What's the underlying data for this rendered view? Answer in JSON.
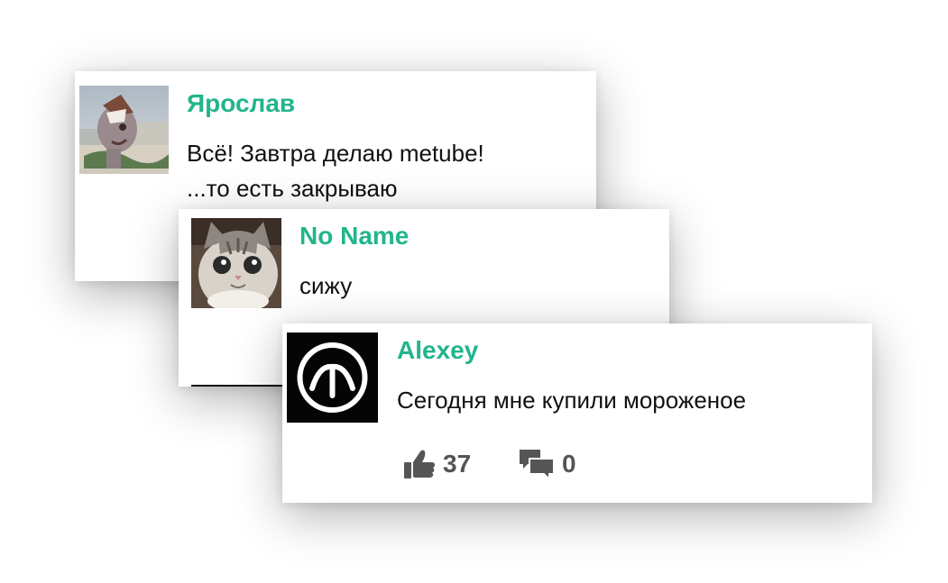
{
  "comments": [
    {
      "author": "Ярослав",
      "text": "Всё! Завтра делаю metube!\n...то есть закрываю"
    },
    {
      "author": "No Name",
      "text": "сижу"
    },
    {
      "author": "Alexey",
      "text": "Сегодня мне купили мороженое",
      "likes": "37",
      "replies": "0"
    }
  ],
  "colors": {
    "author": "#22b58c",
    "text": "#111111",
    "icon": "#555555"
  },
  "icons": {
    "like": "thumbs-up-icon",
    "comment": "comments-icon"
  }
}
